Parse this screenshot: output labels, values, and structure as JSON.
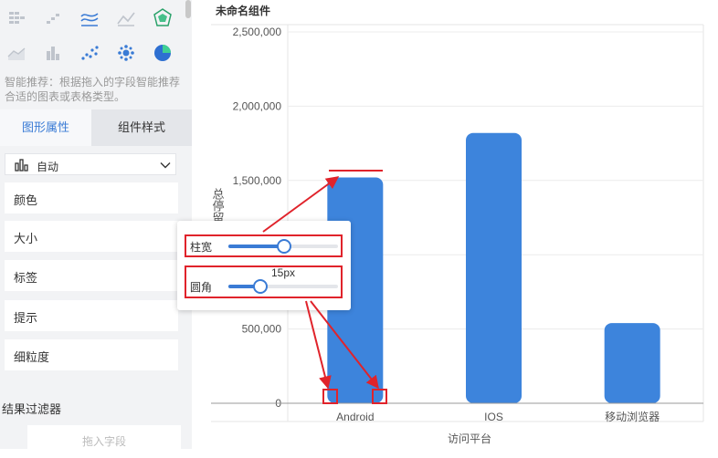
{
  "sidebar": {
    "icons": [
      "cross-table-icon",
      "bar-steps-icon",
      "multi-line-chart-icon",
      "line-chart-icon",
      "radar-chart-icon",
      "area-chart-icon",
      "column-chart-icon",
      "scatter-chart-icon",
      "bubble-chart-icon",
      "pie-chart-icon"
    ],
    "hint": "智能推荐：根据拖入的字段智能推荐合适的图表或表格类型。",
    "tabs": [
      {
        "label": "图形属性"
      },
      {
        "label": "组件样式"
      }
    ],
    "chart_type": "自动",
    "properties": [
      {
        "label": "颜色"
      },
      {
        "label": "大小"
      },
      {
        "label": "标签"
      },
      {
        "label": "提示"
      },
      {
        "label": "细粒度"
      }
    ],
    "filter_title": "结果过滤器",
    "drop_hint": "拖入字段"
  },
  "component": {
    "title": "未命名组件"
  },
  "popup": {
    "width_label": "柱宽",
    "width_level": 0.5,
    "radius_label": "圆角",
    "radius_value": "15px",
    "radius_level": 0.28
  },
  "colors": {
    "accent": "#3a7bd5",
    "bar": "#3d84dc",
    "annotation": "#e0232b"
  },
  "chart_data": {
    "type": "bar",
    "categories": [
      "Android",
      "IOS",
      "移动浏览器"
    ],
    "values": [
      1520000,
      1820000,
      540000
    ],
    "xlabel": "访问平台",
    "ylabel": "总停留",
    "yticks": [
      "0",
      "500,000",
      "1,000,000",
      "1,500,000",
      "2,000,000",
      "2,500,000"
    ],
    "ylim": [
      0,
      2500000
    ],
    "grid": true
  }
}
